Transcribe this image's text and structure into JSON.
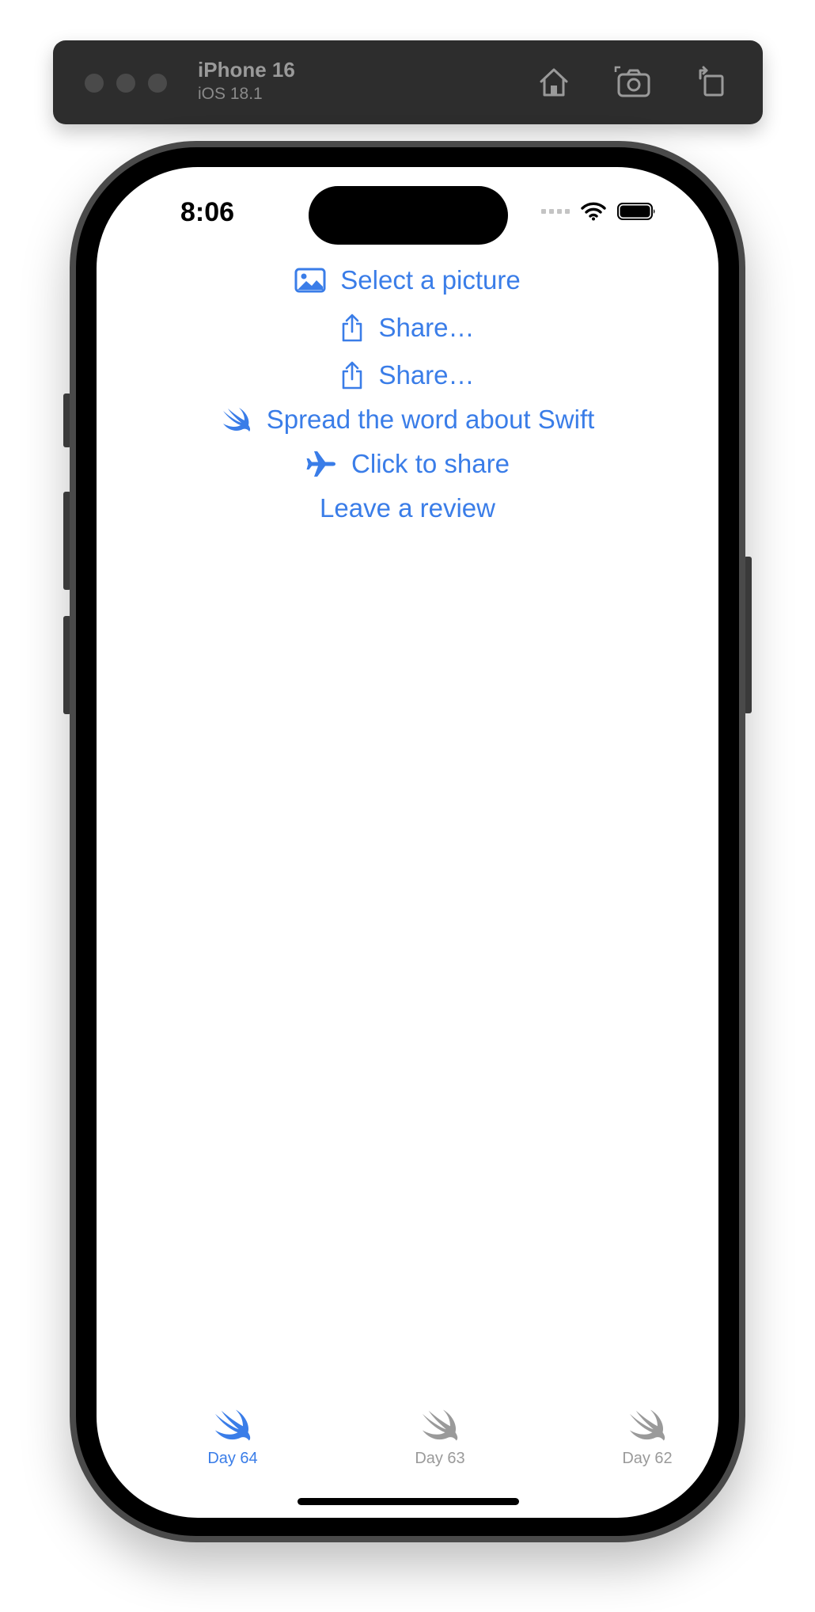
{
  "simulator": {
    "device_name": "iPhone 16",
    "os_version": "iOS 18.1",
    "toolbar_icons": [
      "home-icon",
      "screenshot-icon",
      "rotate-icon"
    ]
  },
  "status_bar": {
    "time": "8:06",
    "icons": [
      "cellular-icon",
      "wifi-icon",
      "battery-icon"
    ]
  },
  "accent_color": "#3a7de8",
  "inactive_color": "#9a9a9a",
  "content": {
    "select_picture": {
      "label": "Select a picture",
      "icon": "photo-icon"
    },
    "share_1": {
      "label": "Share…",
      "icon": "share-icon"
    },
    "share_2": {
      "label": "Share…",
      "icon": "share-icon"
    },
    "spread_word": {
      "label": "Spread the word about Swift",
      "icon": "swift-icon"
    },
    "click_to_share": {
      "label": "Click to share",
      "icon": "airplane-icon"
    },
    "leave_review": {
      "label": "Leave a review"
    }
  },
  "tab_bar": {
    "tabs": [
      {
        "label": "Day 64",
        "icon": "swift-icon",
        "selected": true
      },
      {
        "label": "Day 63",
        "icon": "swift-icon",
        "selected": false
      },
      {
        "label": "Day 62",
        "icon": "swift-icon",
        "selected": false
      }
    ]
  }
}
